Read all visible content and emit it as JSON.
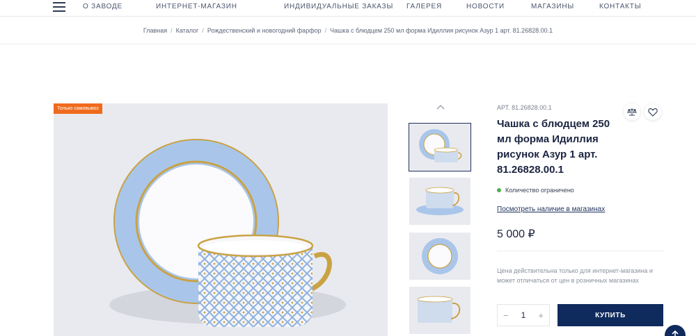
{
  "nav": {
    "items": [
      "О ЗАВОДЕ",
      "ИНТЕРНЕТ-МАГАЗИН",
      "ИНДИВИДУАЛЬНЫЕ ЗАКАЗЫ",
      "ГАЛЕРЕЯ",
      "НОВОСТИ",
      "МАГАЗИНЫ",
      "КОНТАКТЫ"
    ]
  },
  "breadcrumb": {
    "items": [
      "Главная",
      "Каталог",
      "Рождественский и новогодний фарфор",
      "Чашка с блюдцем 250 мл форма Идиллия рисунок Азур 1 арт. 81.26828.00.1"
    ],
    "separator": "/"
  },
  "product": {
    "badge": "Только самовывоз",
    "sku": "АРТ. 81.26828.00.1",
    "title": "Чашка с блюдцем 250 мл форма Идиллия рисунок Азур 1 арт. 81.26828.00.1",
    "stock_status": "Количество ограничено",
    "availability_link": "Посмотреть наличие в магазинах",
    "price": "5 000 ₽",
    "price_note": "Цена действительна только для интернет-магазина и может отличаться от цен в розничных магазинах",
    "quantity": "1",
    "minus": "−",
    "plus": "+",
    "buy_label": "КУПИТЬ"
  },
  "colors": {
    "accent": "#0f2a5c",
    "badge": "#f06a1d",
    "stock_dot": "#4caf50",
    "saucer_blue": "#a9c6ea",
    "gold": "#c9a244"
  },
  "icons": {
    "menu": "hamburger-icon",
    "compare": "scales-icon",
    "favorite": "heart-icon",
    "thumbs_up": "chevron-up-icon",
    "scroll_top": "arrow-up-icon"
  }
}
